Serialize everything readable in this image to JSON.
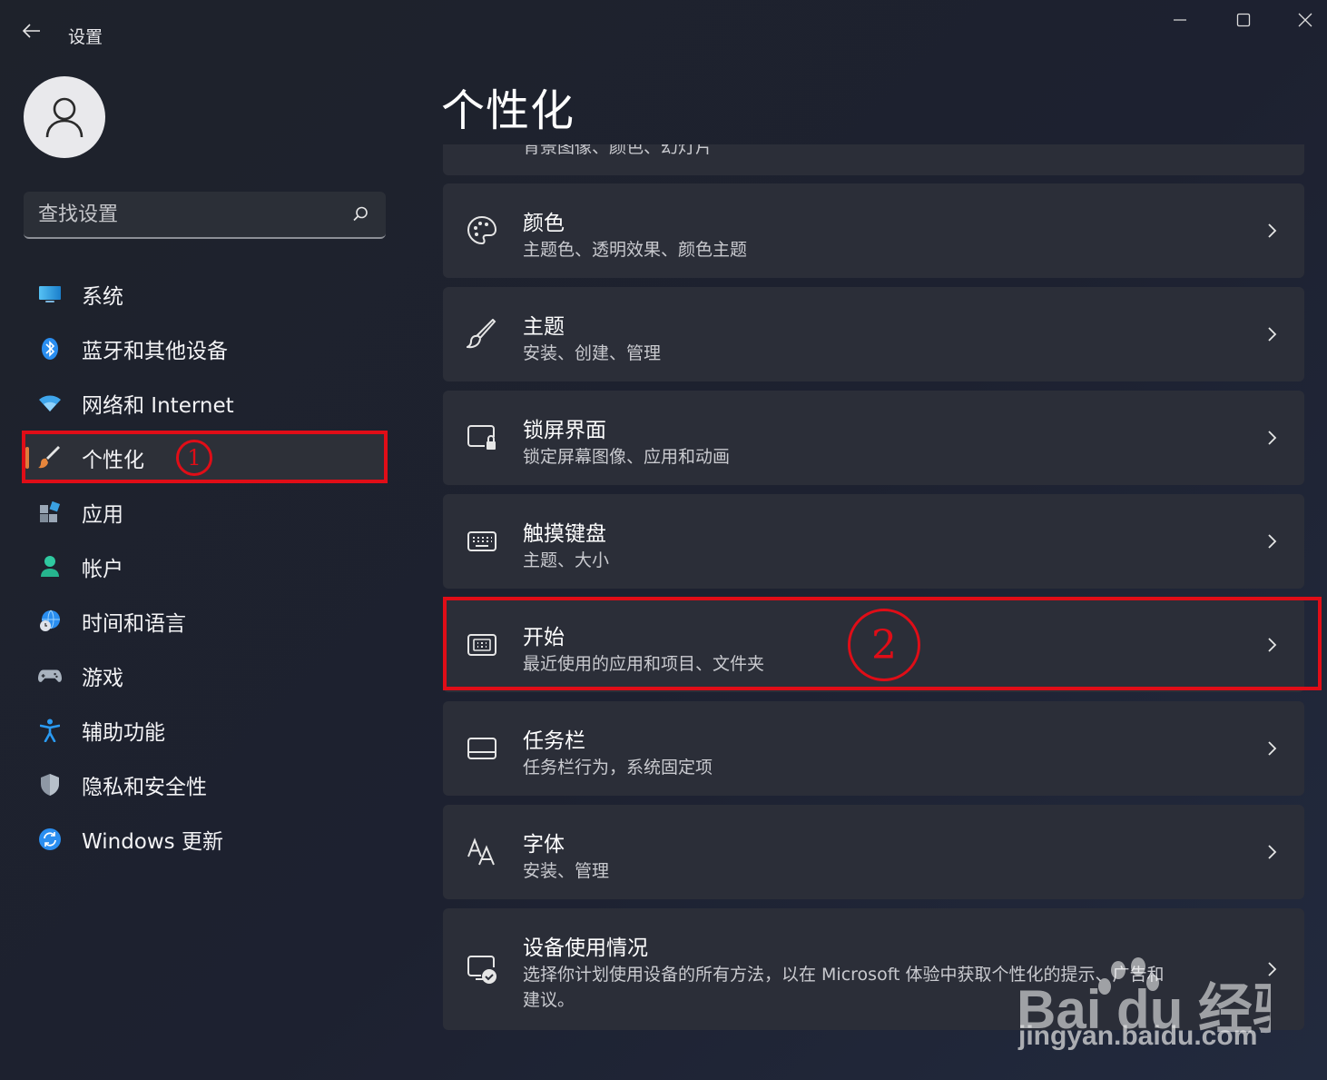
{
  "window": {
    "app_title": "设置",
    "controls": [
      "minimize",
      "maximize",
      "close"
    ]
  },
  "search": {
    "placeholder": "查找设置"
  },
  "sidebar": {
    "items": [
      {
        "label": "系统",
        "icon": "monitor-icon"
      },
      {
        "label": "蓝牙和其他设备",
        "icon": "bluetooth-icon"
      },
      {
        "label": "网络和 Internet",
        "icon": "wifi-icon"
      },
      {
        "label": "个性化",
        "icon": "brush-icon",
        "active": true
      },
      {
        "label": "应用",
        "icon": "apps-icon"
      },
      {
        "label": "帐户",
        "icon": "account-icon"
      },
      {
        "label": "时间和语言",
        "icon": "globe-clock-icon"
      },
      {
        "label": "游戏",
        "icon": "gamepad-icon"
      },
      {
        "label": "辅助功能",
        "icon": "accessibility-icon"
      },
      {
        "label": "隐私和安全性",
        "icon": "shield-icon"
      },
      {
        "label": "Windows 更新",
        "icon": "update-icon"
      }
    ]
  },
  "main": {
    "title": "个性化",
    "partial_card_sub": "背景图像、颜色、幻灯片",
    "cards": [
      {
        "title": "颜色",
        "subtitle": "主题色、透明效果、颜色主题",
        "icon": "palette-icon"
      },
      {
        "title": "主题",
        "subtitle": "安装、创建、管理",
        "icon": "brush-icon"
      },
      {
        "title": "锁屏界面",
        "subtitle": "锁定屏幕图像、应用和动画",
        "icon": "lock-screen-icon"
      },
      {
        "title": "触摸键盘",
        "subtitle": "主题、大小",
        "icon": "keyboard-icon"
      },
      {
        "title": "开始",
        "subtitle": "最近使用的应用和项目、文件夹",
        "icon": "start-menu-icon"
      },
      {
        "title": "任务栏",
        "subtitle": "任务栏行为，系统固定项",
        "icon": "taskbar-icon"
      },
      {
        "title": "字体",
        "subtitle": "安装、管理",
        "icon": "font-icon"
      },
      {
        "title": "设备使用情况",
        "subtitle": "选择你计划使用设备的所有方法，以在 Microsoft 体验中获取个性化的提示、广告和",
        "subtitle2": "建议。",
        "icon": "device-usage-icon"
      }
    ]
  },
  "annotations": {
    "marker1": "1",
    "marker2": "2"
  },
  "watermark": {
    "brand": "Bai du 经验",
    "url": "jingyan.baidu.com"
  },
  "colors": {
    "accent": "#e07b3a",
    "highlight": "#e00d17",
    "card": "#2b2e38"
  }
}
